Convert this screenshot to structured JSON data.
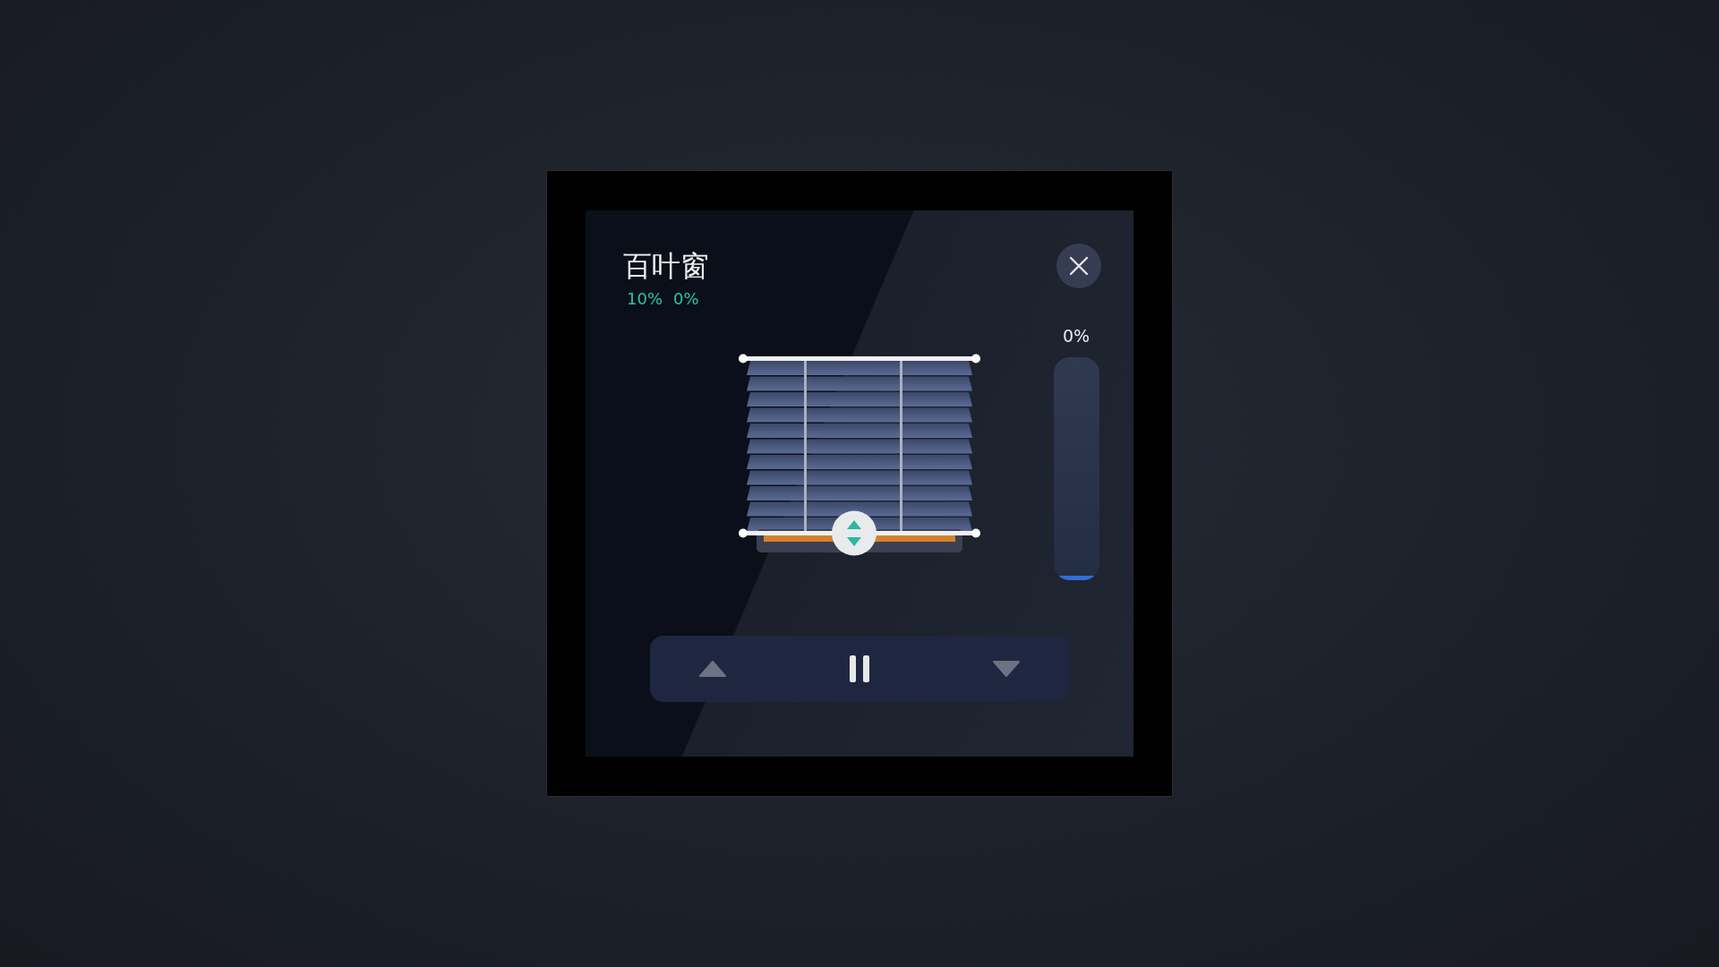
{
  "title": "百叶窗",
  "readings": [
    "10%",
    "0%"
  ],
  "slider": {
    "reading": "0%",
    "level": 0.02
  },
  "controls": [
    {
      "kind": "up",
      "disabled": true
    },
    {
      "kind": "pause",
      "disabled": false
    },
    {
      "kind": "down",
      "disabled": true
    }
  ]
}
